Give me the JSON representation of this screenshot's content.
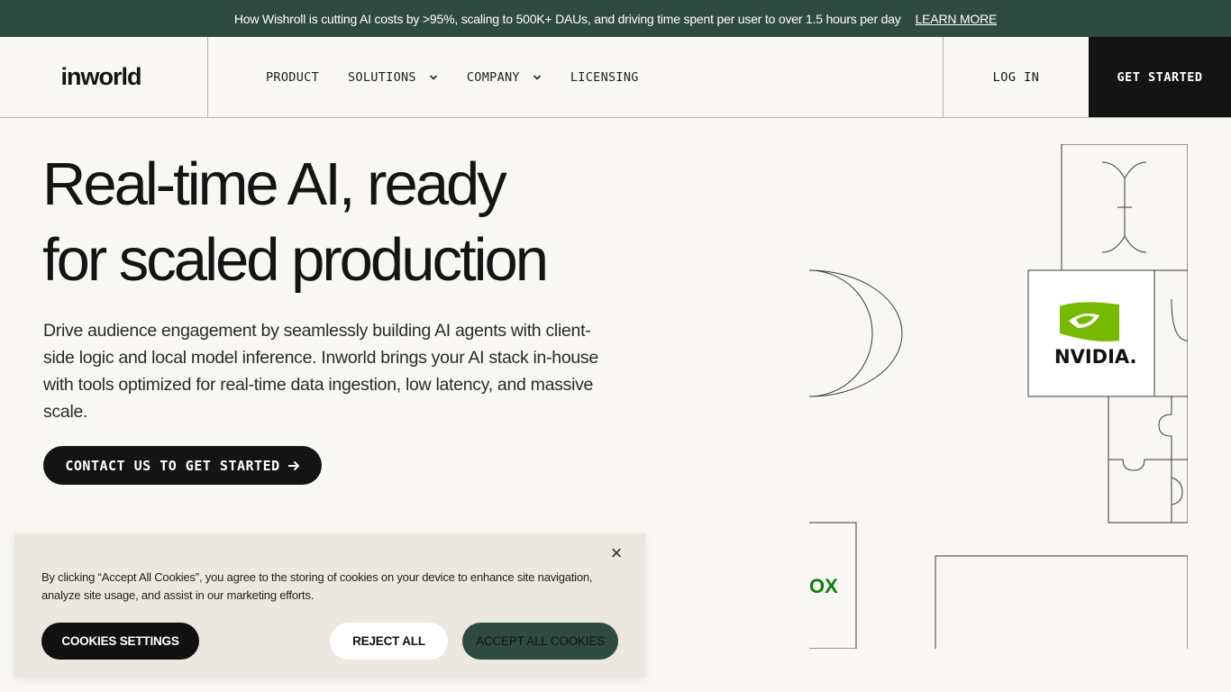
{
  "banner": {
    "text": "How Wishroll is cutting AI costs by >95%, scaling to 500K+ DAUs, and driving time spent per user to over 1.5 hours per day",
    "link": "LEARN MORE"
  },
  "nav": {
    "logo": "inworld",
    "items": [
      {
        "label": "PRODUCT",
        "dropdown": false
      },
      {
        "label": "SOLUTIONS",
        "dropdown": true
      },
      {
        "label": "COMPANY",
        "dropdown": true
      },
      {
        "label": "LICENSING",
        "dropdown": false
      }
    ],
    "login": "LOG IN",
    "cta": "GET STARTED"
  },
  "hero": {
    "headline_line1": "Real-time AI, ready",
    "headline_line2": "for scaled production",
    "subtext": "Drive audience engagement by seamlessly building AI agents with client-side logic and local model inference. Inworld brings your AI stack in-house with tools optimized for real-time data ingestion, low latency, and massive scale.",
    "button": "CONTACT US TO GET STARTED"
  },
  "partners": {
    "nvidia": "NVIDIA.",
    "xbox_partial": "OX"
  },
  "cookie": {
    "text": "By clicking “Accept All Cookies”, you agree to the storing of cookies on your device to enhance site navigation, analyze site usage, and assist in our marketing efforts.",
    "settings": "COOKIES SETTINGS",
    "reject": "REJECT ALL",
    "accept": "ACCEPT ALL COOKIES"
  },
  "colors": {
    "banner_bg": "#2f4a40",
    "page_bg": "#f8f7f3",
    "nvidia_green": "#76b900",
    "xbox_green": "#107c10",
    "dark": "#141414"
  }
}
